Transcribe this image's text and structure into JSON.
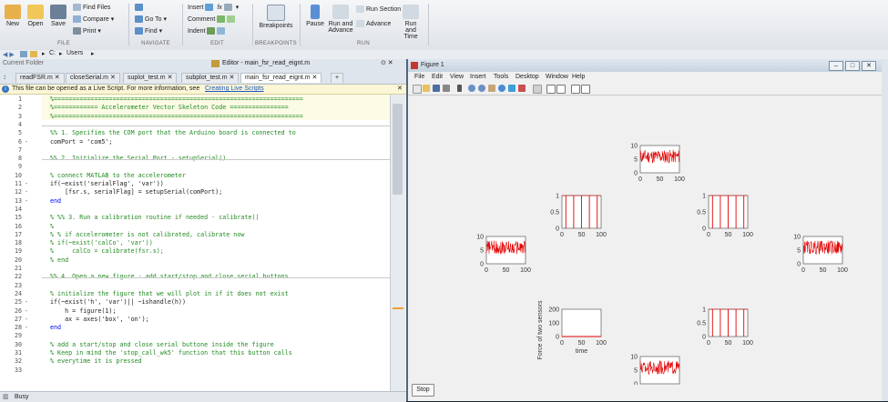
{
  "ribbon": {
    "new": "New",
    "open": "Open",
    "save": "Save",
    "find_files": "Find Files",
    "compare": "Compare",
    "print": "Print",
    "go_to": "Go To",
    "find": "Find",
    "insert": "Insert",
    "comment": "Comment",
    "indent": "Indent",
    "fx": "fx",
    "breakpoints": "Breakpoints",
    "pause": "Pause",
    "run_and_advance": "Run and Advance",
    "run_section": "Run Section",
    "advance": "Advance",
    "run_and_time": "Run and Time",
    "group_file": "FILE",
    "group_navigate": "NAVIGATE",
    "group_edit": "EDIT",
    "group_breakpoints": "BREAKPOINTS",
    "group_run": "RUN"
  },
  "path": {
    "drive": "C:",
    "folder": "Users"
  },
  "editor": {
    "current_folder": "Current Folder",
    "title": "Editor - main_fsr_read_eignt.m",
    "tabs": [
      "readFSR.m",
      "closeSerial.m",
      "suplot_test.m",
      "subplot_test.m",
      "main_fsr_read_eignt.m"
    ],
    "info_text": "This file can be opened as a Live Script. For more information, see ",
    "info_link": "Creating Live Scripts",
    "status": "Busy"
  },
  "code_lines": [
    {
      "n": "1",
      "d": "",
      "t": "%====================================================================",
      "c": "cm"
    },
    {
      "n": "2",
      "d": "",
      "t": "%============ Accelerometer Vector Skeleton Code ================",
      "c": "cm"
    },
    {
      "n": "3",
      "d": "",
      "t": "%====================================================================",
      "c": "cm"
    },
    {
      "n": "4",
      "d": "",
      "t": "",
      "c": ""
    },
    {
      "n": "5",
      "d": "",
      "t": "%% 1. Specifies the COM port that the Arduino board is connected to",
      "c": "cm"
    },
    {
      "n": "6",
      "d": "-",
      "t": "comPort = 'com5';",
      "c": ""
    },
    {
      "n": "7",
      "d": "",
      "t": "",
      "c": ""
    },
    {
      "n": "8",
      "d": "",
      "t": "%% 2. Initialize the Serial Port - setupSerial()",
      "c": "cm"
    },
    {
      "n": "9",
      "d": "",
      "t": "",
      "c": ""
    },
    {
      "n": "10",
      "d": "",
      "t": "% connect MATLAB to the accelerometer",
      "c": "cm"
    },
    {
      "n": "11",
      "d": "-",
      "t": "if(~exist('serialFlag', 'var'))",
      "c": ""
    },
    {
      "n": "12",
      "d": "-",
      "t": "    [fsr.s, serialFlag] = setupSerial(comPort);",
      "c": ""
    },
    {
      "n": "13",
      "d": "-",
      "t": "end",
      "c": "kw"
    },
    {
      "n": "14",
      "d": "",
      "t": "",
      "c": ""
    },
    {
      "n": "15",
      "d": "",
      "t": "% %% 3. Run a calibration routine if needed - calibrate()",
      "c": "cm"
    },
    {
      "n": "16",
      "d": "",
      "t": "%",
      "c": "cm"
    },
    {
      "n": "17",
      "d": "",
      "t": "% % if accelerometer is not calibrated, calibrate now",
      "c": "cm"
    },
    {
      "n": "18",
      "d": "",
      "t": "% if(~exist('calCo', 'var'))",
      "c": "cm"
    },
    {
      "n": "19",
      "d": "",
      "t": "%     calCo = calibrate(fsr.s);",
      "c": "cm"
    },
    {
      "n": "20",
      "d": "",
      "t": "% end",
      "c": "cm"
    },
    {
      "n": "21",
      "d": "",
      "t": "",
      "c": ""
    },
    {
      "n": "22",
      "d": "",
      "t": "%% 4. Open a new figure - add start/stop and close serial buttons",
      "c": "cm"
    },
    {
      "n": "23",
      "d": "",
      "t": "",
      "c": ""
    },
    {
      "n": "24",
      "d": "",
      "t": "% initialize the figure that we will plot in if it does not exist",
      "c": "cm"
    },
    {
      "n": "25",
      "d": "-",
      "t": "if(~exist('h', 'var')|| ~ishandle(h))",
      "c": ""
    },
    {
      "n": "26",
      "d": "-",
      "t": "    h = figure(1);",
      "c": ""
    },
    {
      "n": "27",
      "d": "-",
      "t": "    ax = axes('box', 'on');",
      "c": ""
    },
    {
      "n": "28",
      "d": "-",
      "t": "end",
      "c": "kw"
    },
    {
      "n": "29",
      "d": "",
      "t": "",
      "c": ""
    },
    {
      "n": "30",
      "d": "",
      "t": "% add a start/stop and close serial buttone inside the figure",
      "c": "cm"
    },
    {
      "n": "31",
      "d": "",
      "t": "% Keep in mind the 'stop_call_wk5' function that this button calls",
      "c": "cm"
    },
    {
      "n": "32",
      "d": "",
      "t": "% everytime it is pressed",
      "c": "cm"
    },
    {
      "n": "33",
      "d": "",
      "t": "",
      "c": ""
    }
  ],
  "figure": {
    "title": "Figure 1",
    "menus": [
      "File",
      "Edit",
      "View",
      "Insert",
      "Tools",
      "Desktop",
      "Window",
      "Help"
    ],
    "stop_button": "Stop",
    "window_buttons": [
      "–",
      "□",
      "✕"
    ]
  },
  "chart_data": [
    {
      "type": "line",
      "name": "top-center",
      "color": "#e00000",
      "style": "noise",
      "ylim": [
        0,
        10
      ],
      "yticks": [
        "10",
        "5",
        "0"
      ],
      "xticks": [
        "0",
        "50",
        "100"
      ],
      "xlim": [
        0,
        100
      ],
      "level": 6
    },
    {
      "type": "line",
      "name": "upper-left",
      "color": "#e00000",
      "style": "pulses",
      "ylim": [
        0,
        1
      ],
      "yticks": [
        "1",
        "0.5",
        "0"
      ],
      "xticks": [
        "0",
        "50",
        "100"
      ],
      "xlim": [
        0,
        100
      ],
      "pulses": [
        10,
        30,
        50,
        70,
        90
      ]
    },
    {
      "type": "line",
      "name": "upper-right",
      "color": "#e00000",
      "style": "pulses",
      "ylim": [
        0,
        1
      ],
      "yticks": [
        "1",
        "0.5",
        "0"
      ],
      "xticks": [
        "0",
        "50",
        "100"
      ],
      "xlim": [
        0,
        100
      ],
      "pulses": [
        10,
        30,
        50,
        70,
        90
      ]
    },
    {
      "type": "line",
      "name": "mid-left",
      "color": "#e00000",
      "style": "noise",
      "ylim": [
        0,
        10
      ],
      "yticks": [
        "10",
        "5",
        "0"
      ],
      "xticks": [
        "0",
        "50",
        "100"
      ],
      "xlim": [
        0,
        100
      ],
      "level": 6
    },
    {
      "type": "line",
      "name": "mid-right",
      "color": "#e00000",
      "style": "noise",
      "ylim": [
        0,
        10
      ],
      "yticks": [
        "10",
        "5",
        "0"
      ],
      "xticks": [
        "0",
        "50",
        "100"
      ],
      "xlim": [
        0,
        100
      ],
      "level": 6
    },
    {
      "type": "line",
      "name": "center",
      "color": "#e00000",
      "style": "flat",
      "ylim": [
        0,
        200
      ],
      "yticks": [
        "200",
        "100",
        "0"
      ],
      "xticks": [
        "0",
        "50",
        "100"
      ],
      "xlim": [
        0,
        100
      ],
      "xlabel": "time",
      "ylabel": "Force of two sensors",
      "level": 0
    },
    {
      "type": "line",
      "name": "lower-right",
      "color": "#e00000",
      "style": "pulses",
      "ylim": [
        0,
        1
      ],
      "yticks": [
        "1",
        "0.5",
        "0"
      ],
      "xticks": [
        "0",
        "50",
        "100"
      ],
      "xlim": [
        0,
        100
      ],
      "pulses": [
        10,
        30,
        50,
        70,
        90
      ]
    },
    {
      "type": "line",
      "name": "bottom-center",
      "color": "#e00000",
      "style": "noise",
      "ylim": [
        0,
        10
      ],
      "yticks": [
        "10",
        "5",
        "0"
      ],
      "xticks": [
        "0",
        "50",
        "100"
      ],
      "xlim": [
        0,
        100
      ],
      "level": 6
    }
  ]
}
